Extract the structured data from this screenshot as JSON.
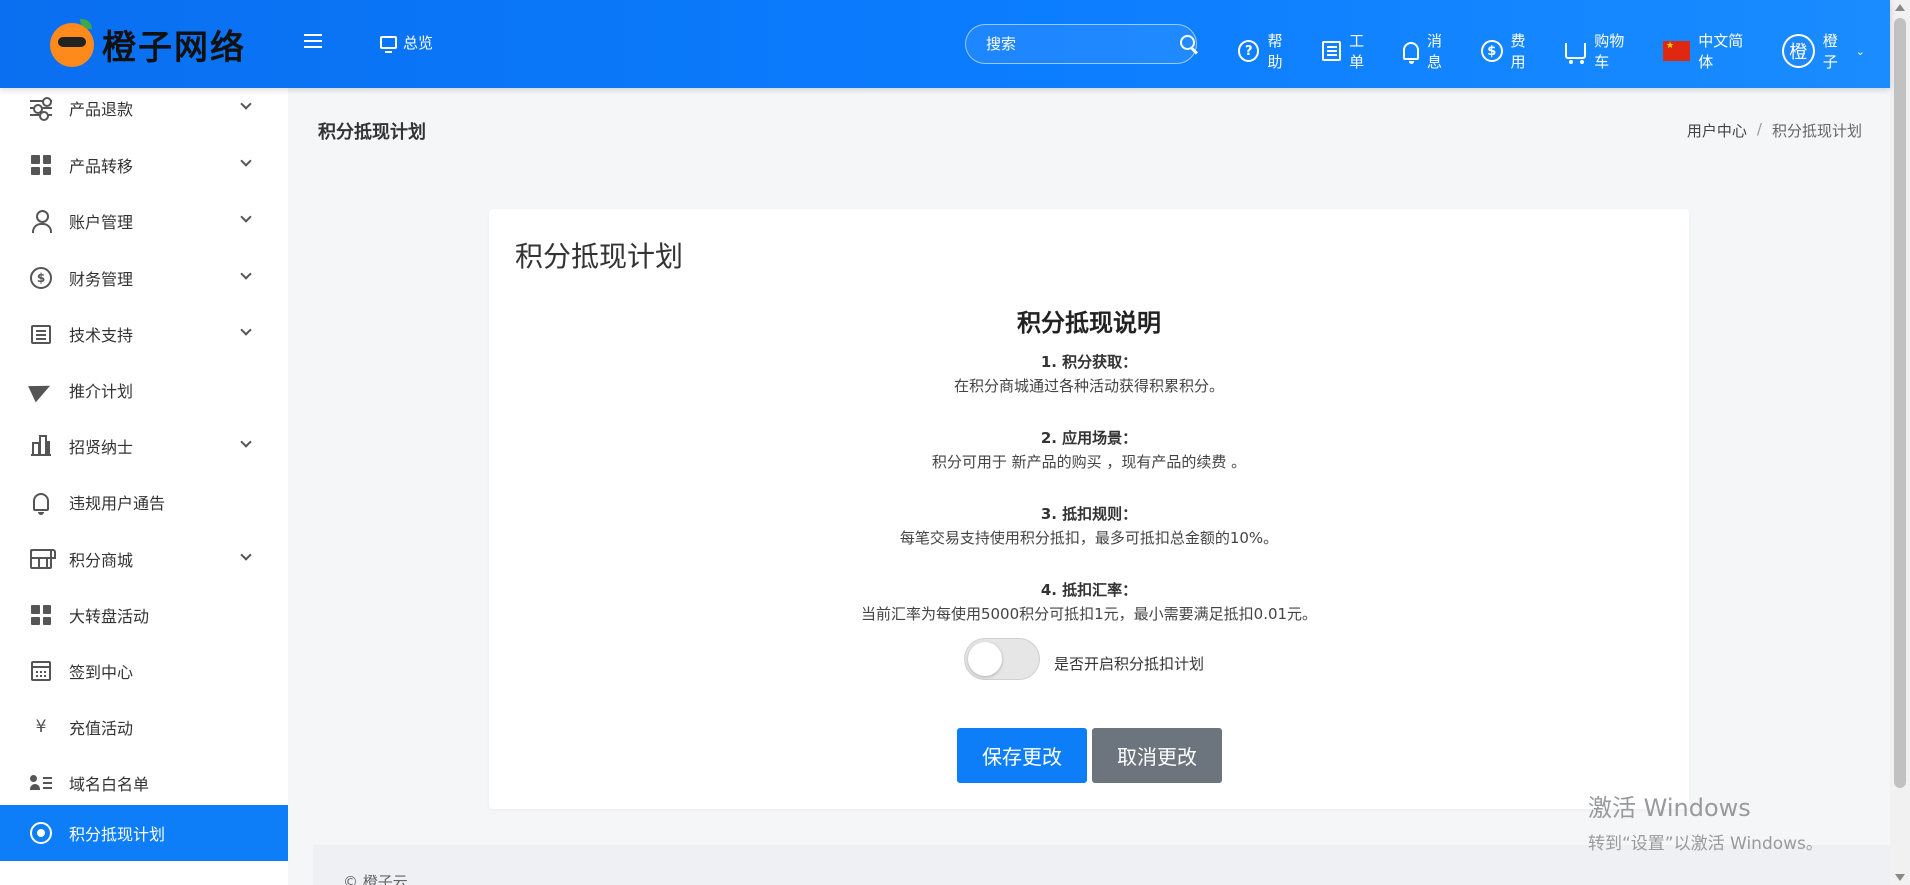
{
  "header": {
    "logo_text": "橙子网络",
    "overview_label": "总览",
    "search_placeholder": "搜索",
    "links": {
      "help": "帮助",
      "ticket": "工单",
      "message": "消息",
      "fee": "费用",
      "cart": "购物车",
      "language": "中文简体",
      "user": "橙子",
      "avatar_char": "橙"
    },
    "help_glyph": "?",
    "fee_glyph": "$"
  },
  "sidebar": {
    "items": [
      {
        "label": "产品退款",
        "icon": "sliders-icon",
        "expandable": true
      },
      {
        "label": "产品转移",
        "icon": "grid-icon",
        "expandable": true
      },
      {
        "label": "账户管理",
        "icon": "person-icon",
        "expandable": true
      },
      {
        "label": "财务管理",
        "icon": "dollar-circle-icon",
        "expandable": true
      },
      {
        "label": "技术支持",
        "icon": "document-lines-icon",
        "expandable": true
      },
      {
        "label": "推介计划",
        "icon": "paper-plane-icon",
        "expandable": false
      },
      {
        "label": "招贤纳士",
        "icon": "bar-chart-icon",
        "expandable": true
      },
      {
        "label": "违规用户通告",
        "icon": "bell-icon",
        "expandable": false
      },
      {
        "label": "积分商城",
        "icon": "store-icon",
        "expandable": true
      },
      {
        "label": "大转盘活动",
        "icon": "grid-icon",
        "expandable": false
      },
      {
        "label": "签到中心",
        "icon": "calendar-icon",
        "expandable": false
      },
      {
        "label": "充值活动",
        "icon": "yen-icon",
        "expandable": false
      },
      {
        "label": "域名白名单",
        "icon": "id-card-icon",
        "expandable": false
      },
      {
        "label": "积分抵现计划",
        "icon": "target-icon",
        "expandable": false,
        "active": true
      }
    ],
    "yen_glyph": "¥"
  },
  "page": {
    "title": "积分抵现计划",
    "breadcrumb": {
      "home": "用户中心",
      "separator": "/",
      "current": "积分抵现计划"
    }
  },
  "card": {
    "title": "积分抵现计划",
    "explain_title": "积分抵现说明",
    "rules": [
      {
        "title": "1. 积分获取：",
        "desc": "在积分商城通过各种活动获得积累积分。"
      },
      {
        "title": "2. 应用场景：",
        "desc": "积分可用于 新产品的购买 ，现有产品的续费 。"
      },
      {
        "title": "3. 抵扣规则：",
        "desc": "每笔交易支持使用积分抵扣，最多可抵扣总金额的10%。"
      },
      {
        "title": "4. 抵扣汇率：",
        "desc": "当前汇率为每使用5000积分可抵扣1元，最小需要满足抵扣0.01元。"
      }
    ],
    "toggle_label": "是否开启积分抵扣计划",
    "toggle_on": false,
    "save_label": "保存更改",
    "cancel_label": "取消更改"
  },
  "footer": {
    "copyright": "© 橙子云"
  },
  "watermark": {
    "line1": "激活 Windows",
    "line2": "转到“设置”以激活 Windows。"
  },
  "colors": {
    "primary": "#0d7ef7",
    "header_start": "#0a6ff0",
    "header_end": "#1a8cff",
    "cancel": "#6c757d"
  }
}
